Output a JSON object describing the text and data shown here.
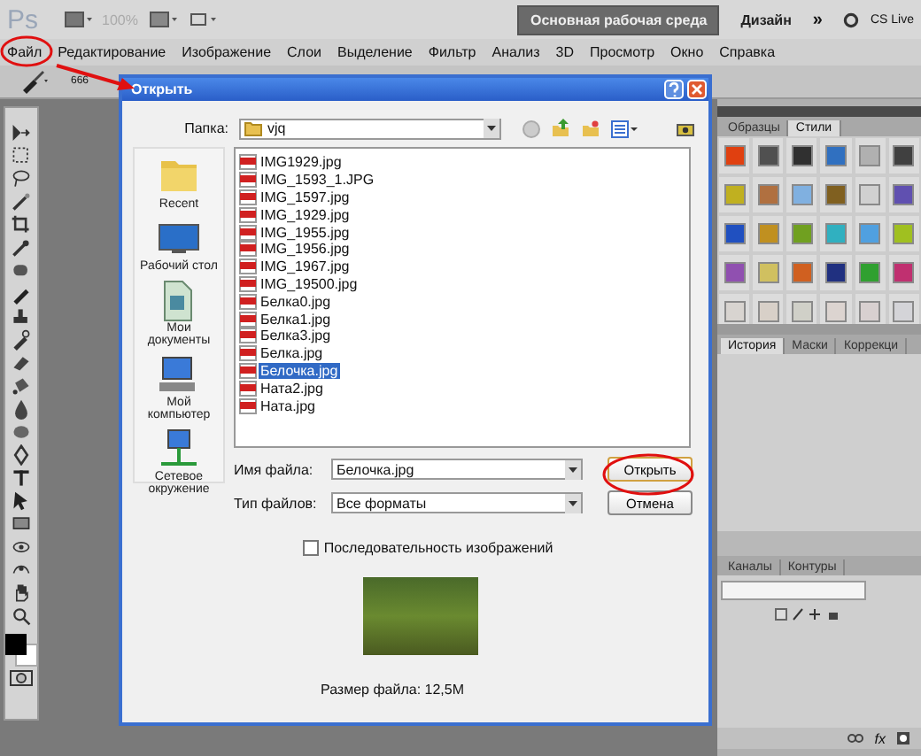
{
  "app_bar": {
    "logo": "Ps",
    "zoom": "100%",
    "workspace_button": "Основная рабочая среда",
    "workspace_link": "Дизайн",
    "more": "»",
    "cs_live": "CS Live"
  },
  "menu": [
    "Файл",
    "Редактирование",
    "Изображение",
    "Слои",
    "Выделение",
    "Фильтр",
    "Анализ",
    "3D",
    "Просмотр",
    "Окно",
    "Справка"
  ],
  "options_bar": {
    "brush_size": "666"
  },
  "dialog": {
    "title": "Открыть",
    "folder_label": "Папка:",
    "folder": "vjq",
    "places": [
      {
        "kind": "recent",
        "label": "Recent"
      },
      {
        "kind": "desktop",
        "label": "Рабочий стол"
      },
      {
        "kind": "documents",
        "label": "Мои документы"
      },
      {
        "kind": "computer",
        "label": "Мой компьютер"
      },
      {
        "kind": "network",
        "label": "Сетевое окружение"
      }
    ],
    "files": [
      {
        "name": "IMG1929.jpg",
        "selected": false
      },
      {
        "name": "IMG_1593_1.JPG",
        "selected": false
      },
      {
        "name": "IMG_1597.jpg",
        "selected": false
      },
      {
        "name": "IMG_1929.jpg",
        "selected": false
      },
      {
        "name": "IMG_1955.jpg",
        "selected": false
      },
      {
        "name": "IMG_1956.jpg",
        "selected": false
      },
      {
        "name": "IMG_1967.jpg",
        "selected": false
      },
      {
        "name": "IMG_19500.jpg",
        "selected": false
      },
      {
        "name": "Белка0.jpg",
        "selected": false
      },
      {
        "name": "Белка1.jpg",
        "selected": false
      },
      {
        "name": "Белка3.jpg",
        "selected": false
      },
      {
        "name": "Белка.jpg",
        "selected": false
      },
      {
        "name": "Белочка.jpg",
        "selected": true
      },
      {
        "name": "Ната2.jpg",
        "selected": false
      },
      {
        "name": "Ната.jpg",
        "selected": false
      }
    ],
    "filename_label": "Имя файла:",
    "filename": "Белочка.jpg",
    "type_label": "Тип файлов:",
    "type": "Все форматы",
    "open_button": "Открыть",
    "cancel_button": "Отмена",
    "sequence": {
      "label": "Последовательность изображений",
      "checked": false
    },
    "file_size": "Размер файла: 12,5M"
  },
  "styles_panel": {
    "tabs": [
      {
        "label": "Образцы",
        "selected": false
      },
      {
        "label": "Стили",
        "selected": true
      }
    ],
    "swatches": [
      {
        "color": "#e04010"
      },
      {
        "color": "#505050"
      },
      {
        "color": "#303030"
      },
      {
        "color": "#3070c0"
      },
      {
        "color": "#b0b0b0"
      },
      {
        "color": "#404040"
      },
      {
        "color": "#c0b020"
      },
      {
        "color": "#b07040"
      },
      {
        "color": "#80b0e0"
      },
      {
        "color": "#806020"
      },
      {
        "color": "#d0d0d0"
      },
      {
        "color": "#6050b0"
      },
      {
        "color": "#2050c0"
      },
      {
        "color": "#c09020"
      },
      {
        "color": "#70a020"
      },
      {
        "color": "#30b0c0"
      },
      {
        "color": "#50a0e0"
      },
      {
        "color": "#a0c020"
      },
      {
        "color": "#9050b0"
      },
      {
        "color": "#d0c060"
      },
      {
        "color": "#d06020"
      },
      {
        "color": "#203080"
      },
      {
        "color": "#30a030"
      },
      {
        "color": "#c03070"
      },
      {
        "color": "#d8d4d0"
      },
      {
        "color": "#d8d0c8"
      },
      {
        "color": "#d0d0c8"
      },
      {
        "color": "#dcd4d0"
      },
      {
        "color": "#d8d0d0"
      },
      {
        "color": "#d4d4d8"
      }
    ]
  },
  "history_panel": {
    "tabs": [
      {
        "label": "История",
        "selected": true
      },
      {
        "label": "Маски",
        "selected": false
      },
      {
        "label": "Коррекци",
        "selected": false
      }
    ]
  },
  "layers_panel": {
    "tabs": [
      {
        "label": "Каналы",
        "selected": false
      },
      {
        "label": "Контуры",
        "selected": false
      }
    ],
    "fx": "fx"
  }
}
